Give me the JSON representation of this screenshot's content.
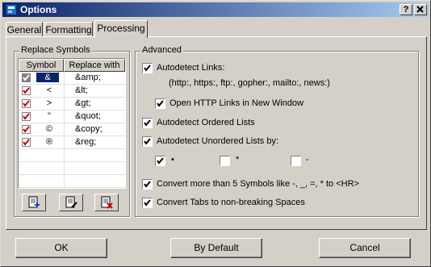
{
  "window": {
    "title": "Options",
    "help_label": "?",
    "close_label": "✕"
  },
  "tabs": [
    {
      "label": "General"
    },
    {
      "label": "Formatting"
    },
    {
      "label": "Processing"
    }
  ],
  "replace_symbols": {
    "legend": "Replace Symbols",
    "columns": [
      "Symbol",
      "Replace with"
    ],
    "rows": [
      {
        "checked": true,
        "symbol": "&",
        "replace": "&amp;",
        "selected": true
      },
      {
        "checked": true,
        "symbol": "<",
        "replace": "&lt;"
      },
      {
        "checked": true,
        "symbol": ">",
        "replace": "&gt;"
      },
      {
        "checked": true,
        "symbol": "\"",
        "replace": "&quot;"
      },
      {
        "checked": true,
        "symbol": "©",
        "replace": "&copy;"
      },
      {
        "checked": true,
        "symbol": "®",
        "replace": "&reg;"
      }
    ],
    "buttons": [
      "add-row-icon",
      "edit-row-icon",
      "delete-row-icon"
    ]
  },
  "advanced": {
    "legend": "Advanced",
    "autodetect_links": {
      "label": "Autodetect Links:",
      "checked": true
    },
    "links_note": "(http:, https:, ftp:, gopher:, mailto:, news:)",
    "open_new_window": {
      "label": "Open HTTP Links in New Window",
      "checked": true
    },
    "ordered_lists": {
      "label": "Autodetect Ordered Lists",
      "checked": true
    },
    "unordered_lists": {
      "label": "Autodetect Unordered Lists by:",
      "checked": true
    },
    "bullets": [
      {
        "symbol": "•",
        "checked": true
      },
      {
        "symbol": "*",
        "checked": false
      },
      {
        "symbol": "-",
        "checked": false
      }
    ],
    "convert_symbols": {
      "label": "Convert more than 5 Symbols like -, _, =, * to <HR>",
      "checked": true
    },
    "convert_tabs": {
      "label": "Convert Tabs to non-breaking Spaces",
      "checked": true
    }
  },
  "footer": {
    "ok": "OK",
    "default": "By Default",
    "cancel": "Cancel"
  },
  "colors": {
    "title_start": "#0a246a",
    "title_end": "#a6caf0",
    "check_red": "#cc0000"
  }
}
